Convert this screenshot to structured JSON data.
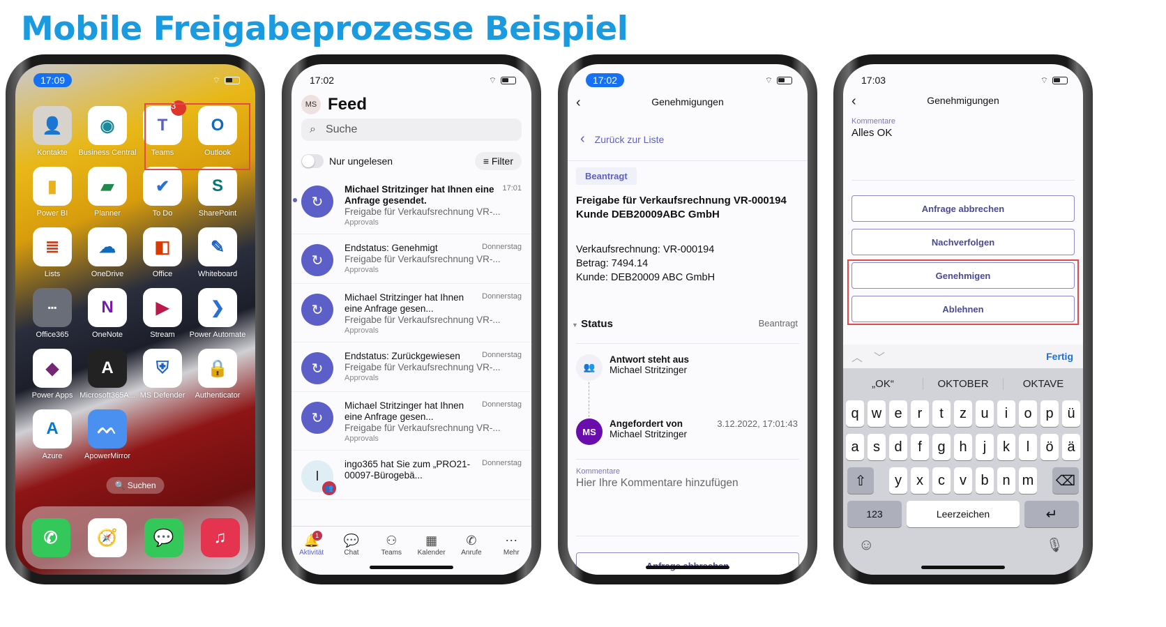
{
  "title": "Mobile Freigabeprozesse Beispiel",
  "colors": {
    "title": "#1a9be0",
    "teams_purple": "#5b5fc7",
    "highlight_red": "#e54848",
    "ios_blue": "#1671f2"
  },
  "phone1": {
    "time": "17:09",
    "apps": [
      {
        "label": "Kontakte",
        "icon": "contacts-icon"
      },
      {
        "label": "Business Central",
        "icon": "business-central-icon"
      },
      {
        "label": "Teams",
        "icon": "teams-icon",
        "badge": "3"
      },
      {
        "label": "Outlook",
        "icon": "outlook-icon"
      },
      {
        "label": "Power BI",
        "icon": "power-bi-icon"
      },
      {
        "label": "Planner",
        "icon": "planner-icon"
      },
      {
        "label": "To Do",
        "icon": "todo-icon"
      },
      {
        "label": "SharePoint",
        "icon": "sharepoint-icon"
      },
      {
        "label": "Lists",
        "icon": "lists-icon"
      },
      {
        "label": "OneDrive",
        "icon": "onedrive-icon"
      },
      {
        "label": "Office",
        "icon": "office-icon"
      },
      {
        "label": "Whiteboard",
        "icon": "whiteboard-icon"
      },
      {
        "label": "Office365",
        "icon": "folder-icon"
      },
      {
        "label": "OneNote",
        "icon": "onenote-icon"
      },
      {
        "label": "Stream",
        "icon": "stream-icon"
      },
      {
        "label": "Power Automate",
        "icon": "power-automate-icon"
      },
      {
        "label": "Power Apps",
        "icon": "power-apps-icon"
      },
      {
        "label": "Microsoft365A...",
        "icon": "m365-admin-icon"
      },
      {
        "label": "MS Defender",
        "icon": "defender-icon"
      },
      {
        "label": "Authenticator",
        "icon": "authenticator-icon"
      },
      {
        "label": "Azure",
        "icon": "azure-icon"
      },
      {
        "label": "ApowerMirror",
        "icon": "apowermirror-icon"
      }
    ],
    "search_label": "Suchen",
    "dock": [
      "phone-icon",
      "safari-icon",
      "messages-icon",
      "music-icon"
    ]
  },
  "phone2": {
    "time": "17:02",
    "avatar": "MS",
    "title": "Feed",
    "search_placeholder": "Suche",
    "toggle_label": "Nur ungelesen",
    "filter_label": "Filter",
    "feed": [
      {
        "title": "Michael Stritzinger hat Ihnen eine Anfrage gesendet.",
        "time": "17:01",
        "sub": "Freigabe für Verkaufsrechnung VR-...",
        "source": "Approvals",
        "unread": true
      },
      {
        "title": "Endstatus: Genehmigt",
        "time": "Donnerstag",
        "sub": "Freigabe für Verkaufsrechnung VR-...",
        "source": "Approvals"
      },
      {
        "title": "Michael Stritzinger hat Ihnen eine Anfrage gesen...",
        "time": "Donnerstag",
        "sub": "Freigabe für Verkaufsrechnung VR-...",
        "source": "Approvals"
      },
      {
        "title": "Endstatus: Zurückgewiesen",
        "time": "Donnerstag",
        "sub": "Freigabe für Verkaufsrechnung VR-...",
        "source": "Approvals"
      },
      {
        "title": "Michael Stritzinger hat Ihnen eine Anfrage gesen...",
        "time": "Donnerstag",
        "sub": "Freigabe für Verkaufsrechnung VR-...",
        "source": "Approvals"
      },
      {
        "title": "ingo365 hat Sie zum „PRO21-00097-Bürogebä...",
        "time": "Donnerstag",
        "avatar": "I"
      }
    ],
    "tabs": [
      {
        "label": "Aktivität",
        "icon": "bell-icon",
        "badge": "1",
        "active": true
      },
      {
        "label": "Chat",
        "icon": "chat-icon"
      },
      {
        "label": "Teams",
        "icon": "teams-tab-icon"
      },
      {
        "label": "Kalender",
        "icon": "calendar-icon"
      },
      {
        "label": "Anrufe",
        "icon": "phone-call-icon"
      },
      {
        "label": "Mehr",
        "icon": "more-icon"
      }
    ]
  },
  "phone3": {
    "time": "17:02",
    "nav_title": "Genehmigungen",
    "back_link": "Zurück zur Liste",
    "tag": "Beantragt",
    "heading": "Freigabe für Verkaufsrechnung VR-000194 Kunde DEB20009ABC GmbH",
    "details": [
      "Verkaufsrechnung: VR-000194",
      "Betrag:  7494.14",
      "Kunde: DEB20009 ABC  GmbH"
    ],
    "status_label": "Status",
    "status_value": "Beantragt",
    "steps": [
      {
        "title": "Antwort steht aus",
        "name": "Michael Stritzinger"
      },
      {
        "title": "Angefordert von",
        "name": "Michael Stritzinger",
        "time": "3.12.2022, 17:01:43",
        "avatar": "MS"
      }
    ],
    "comments_label": "Kommentare",
    "comments_placeholder": "Hier Ihre Kommentare hinzufügen",
    "cancel_button": "Anfrage abbrechen"
  },
  "phone4": {
    "time": "17:03",
    "nav_title": "Genehmigungen",
    "comments_label": "Kommentare",
    "comments_value": "Alles OK",
    "buttons": [
      "Anfrage abbrechen",
      "Nachverfolgen",
      "Genehmigen",
      "Ablehnen"
    ],
    "done_label": "Fertig",
    "suggestions": [
      "„OK“",
      "OKTOBER",
      "OKTAVE"
    ],
    "rows": [
      [
        "q",
        "w",
        "e",
        "r",
        "t",
        "z",
        "u",
        "i",
        "o",
        "p",
        "ü"
      ],
      [
        "a",
        "s",
        "d",
        "f",
        "g",
        "h",
        "j",
        "k",
        "l",
        "ö",
        "ä"
      ],
      [
        "y",
        "x",
        "c",
        "v",
        "b",
        "n",
        "m"
      ]
    ],
    "numbers_key": "123",
    "space_key": "Leerzeichen"
  }
}
